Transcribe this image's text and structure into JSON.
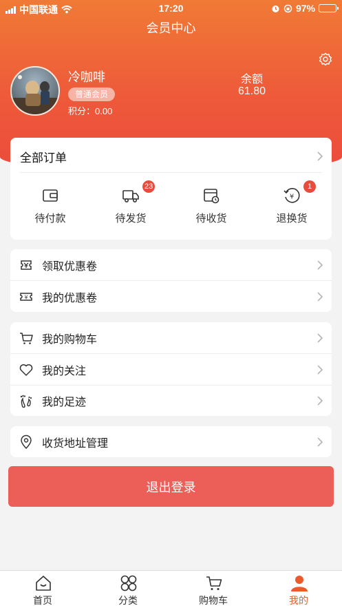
{
  "status_bar": {
    "carrier": "中国联通",
    "time": "17:20",
    "battery": "97%"
  },
  "header": {
    "title": "会员中心"
  },
  "profile": {
    "username": "冷咖啡",
    "member_level": "普通会员",
    "points_label": "积分：",
    "points_value": "0.00",
    "balance_label": "余额",
    "balance_value": "61.80"
  },
  "orders": {
    "title": "全部订单",
    "items": [
      {
        "label": "待付款",
        "icon": "wallet-icon",
        "badge": ""
      },
      {
        "label": "待发货",
        "icon": "truck-icon",
        "badge": "23"
      },
      {
        "label": "待收货",
        "icon": "package-clock-icon",
        "badge": ""
      },
      {
        "label": "退换货",
        "icon": "yen-return-icon",
        "badge": "1"
      }
    ]
  },
  "coupons": [
    {
      "label": "领取优惠卷",
      "icon": "coupon-receive-icon"
    },
    {
      "label": "我的优惠卷",
      "icon": "yen-ticket-icon"
    }
  ],
  "activity": [
    {
      "label": "我的购物车",
      "icon": "cart-icon"
    },
    {
      "label": "我的关注",
      "icon": "heart-icon"
    },
    {
      "label": "我的足迹",
      "icon": "footprint-icon"
    }
  ],
  "address": {
    "label": "收货地址管理",
    "icon": "location-pin-icon"
  },
  "logout_label": "退出登录",
  "tabbar": [
    {
      "label": "首页",
      "icon": "home-icon",
      "active": false
    },
    {
      "label": "分类",
      "icon": "category-icon",
      "active": false
    },
    {
      "label": "购物车",
      "icon": "cart-icon",
      "active": false
    },
    {
      "label": "我的",
      "icon": "person-icon",
      "active": true
    }
  ],
  "colors": {
    "header_top": "#f07a35",
    "header_bottom": "#ec4b3c",
    "logout": "#ec5f59",
    "badge": "#e84c3d",
    "active_tab": "#ec5a2c"
  }
}
